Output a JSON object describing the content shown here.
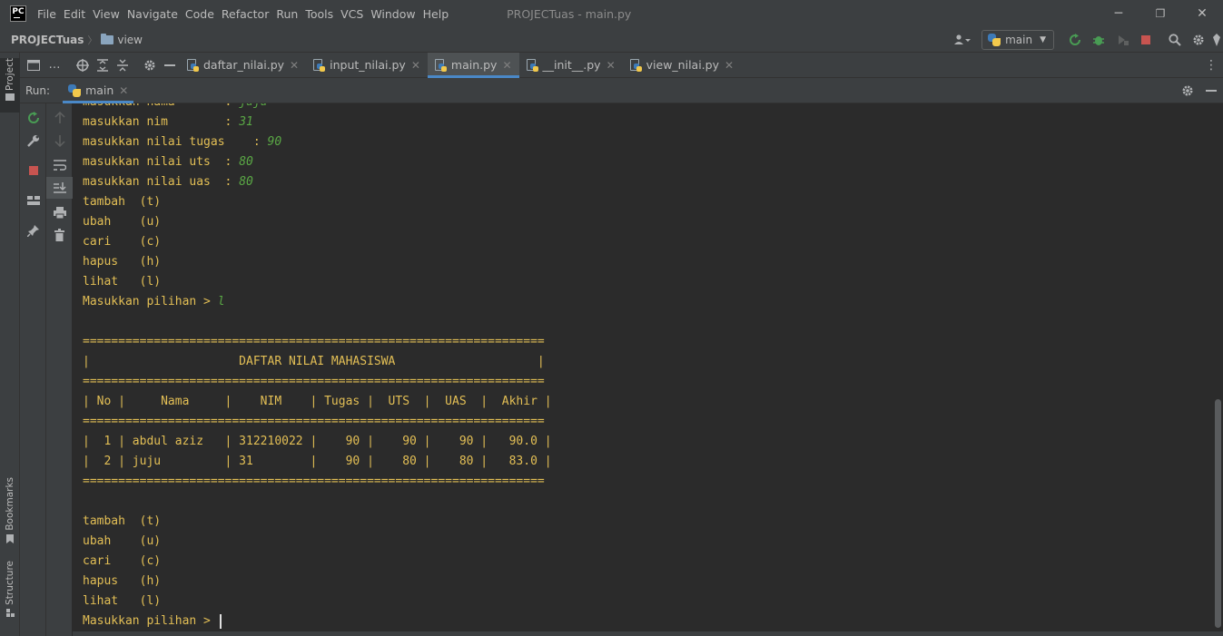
{
  "window": {
    "title": "PROJECTuas - main.py",
    "logo_text": "PC",
    "minimize": "─",
    "maximize": "❐",
    "close": "✕"
  },
  "menu": [
    "File",
    "Edit",
    "View",
    "Navigate",
    "Code",
    "Refactor",
    "Run",
    "Tools",
    "VCS",
    "Window",
    "Help"
  ],
  "navbar": {
    "project": "PROJECTuas",
    "separator": "〉",
    "folder": "view",
    "run_config": "main"
  },
  "side_tabs": {
    "project": "Project",
    "bookmarks": "Bookmarks",
    "structure": "Structure"
  },
  "editor_tabs": [
    {
      "label": "daftar_nilai.py",
      "active": false
    },
    {
      "label": "input_nilai.py",
      "active": false
    },
    {
      "label": "main.py",
      "active": true
    },
    {
      "label": "__init__.py",
      "active": false
    },
    {
      "label": "view_nilai.py",
      "active": false
    }
  ],
  "run_panel": {
    "label": "Run:",
    "tab": "main"
  },
  "console": {
    "lines": [
      {
        "prompt": "masukkan nama       : ",
        "input": "juju"
      },
      {
        "prompt": "masukkan nim        : ",
        "input": "31"
      },
      {
        "prompt": "masukkan nilai tugas    : ",
        "input": "90"
      },
      {
        "prompt": "masukkan nilai uts  : ",
        "input": "80"
      },
      {
        "prompt": "masukkan nilai uas  : ",
        "input": "80"
      },
      {
        "prompt": "tambah  (t)",
        "input": ""
      },
      {
        "prompt": "ubah    (u)",
        "input": ""
      },
      {
        "prompt": "cari    (c)",
        "input": ""
      },
      {
        "prompt": "hapus   (h)",
        "input": ""
      },
      {
        "prompt": "lihat   (l)",
        "input": ""
      },
      {
        "prompt": "Masukkan pilihan > ",
        "input": "l"
      },
      {
        "prompt": "",
        "input": ""
      },
      {
        "prompt": "=================================================================",
        "input": ""
      },
      {
        "prompt": "|                     DAFTAR NILAI MAHASISWA                    |",
        "input": ""
      },
      {
        "prompt": "=================================================================",
        "input": ""
      },
      {
        "prompt": "| No |     Nama     |    NIM    | Tugas |  UTS  |  UAS  |  Akhir |",
        "input": ""
      },
      {
        "prompt": "=================================================================",
        "input": ""
      },
      {
        "prompt": "|  1 | abdul aziz   | 312210022 |    90 |    90 |    90 |   90.0 |",
        "input": ""
      },
      {
        "prompt": "|  2 | juju         | 31        |    90 |    80 |    80 |   83.0 |",
        "input": ""
      },
      {
        "prompt": "=================================================================",
        "input": ""
      },
      {
        "prompt": "",
        "input": ""
      },
      {
        "prompt": "tambah  (t)",
        "input": ""
      },
      {
        "prompt": "ubah    (u)",
        "input": ""
      },
      {
        "prompt": "cari    (c)",
        "input": ""
      },
      {
        "prompt": "hapus   (h)",
        "input": ""
      },
      {
        "prompt": "lihat   (l)",
        "input": ""
      },
      {
        "prompt": "Masukkan pilihan > ",
        "input": ""
      }
    ]
  },
  "colors": {
    "console_output": "#e3bf55",
    "console_input": "#5aa845",
    "tab_underline": "#4a88c7",
    "stop_red": "#c75450",
    "run_green": "#499c54"
  }
}
